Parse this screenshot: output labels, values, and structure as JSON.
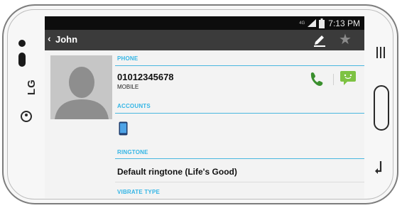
{
  "device": {
    "brand": "LG"
  },
  "status_bar": {
    "network": "4G",
    "time": "7:13 PM"
  },
  "action_bar": {
    "back_symbol": "‹",
    "title": "John",
    "edit_icon": "pencil-icon",
    "favorite_icon": "star-icon"
  },
  "phone": {
    "header": "PHONE",
    "number": "01012345678",
    "type": "MOBILE",
    "call_icon": "phone-call-icon",
    "message_icon": "message-icon"
  },
  "accounts": {
    "header": "ACCOUNTS",
    "icon": "phone-device-icon"
  },
  "ringtone": {
    "header": "RINGTONE",
    "value": "Default ringtone (Life's Good)"
  },
  "vibrate": {
    "header": "VIBRATE TYPE"
  },
  "colors": {
    "accent": "#33b5e5",
    "action_bar": "#3b3b3b",
    "call_green": "#3a8f2e",
    "message_green": "#7dc242"
  }
}
